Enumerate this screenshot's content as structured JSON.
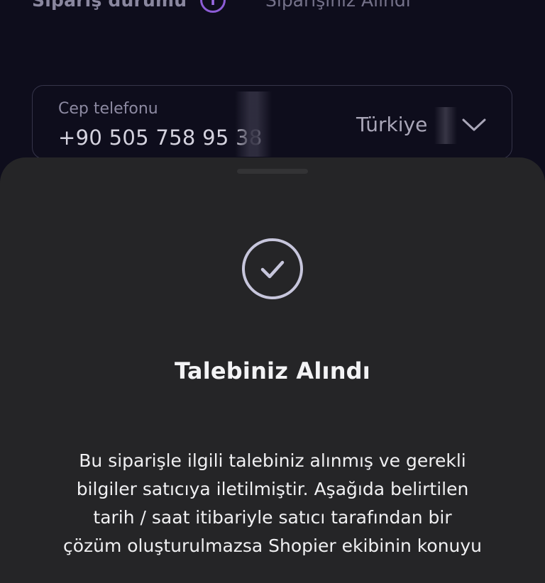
{
  "order_status": {
    "label": "Sipariş durumu",
    "info_icon": "i",
    "value": "Siparişiniz Alındı"
  },
  "phone": {
    "label": "Cep telefonu",
    "value": "+90 505 758 95 38",
    "country": "Türkiye"
  },
  "sheet": {
    "title": "Talebiniz Alındı",
    "body_lines": [
      "Bu siparişle ilgili talebiniz alınmış ve gerekli",
      "bilgiler satıcıya iletilmiştir. Aşağıda belirtilen",
      "tarih / saat itibariyle satıcı tarafından bir",
      "çözüm oluşturulmazsa Shopier ekibinin konuyu"
    ]
  },
  "colors": {
    "background": "#0e0d1c",
    "sheet": "#252527",
    "accent": "#8c5cd6",
    "check": "#c7c6dc"
  }
}
